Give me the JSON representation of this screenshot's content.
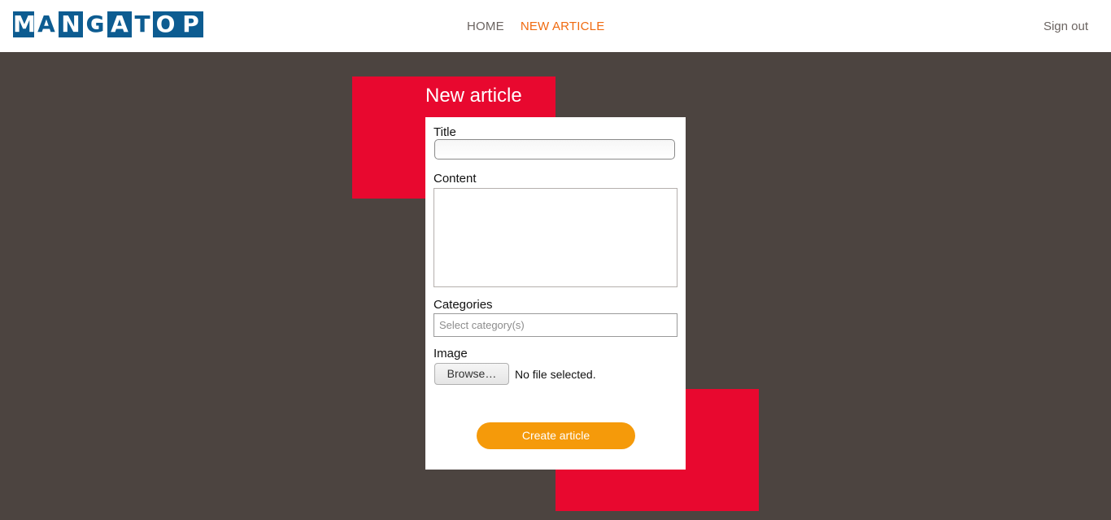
{
  "header": {
    "logo_letters": [
      "M",
      "A",
      "N",
      "G",
      "A",
      "T",
      "O",
      "P"
    ],
    "nav": [
      {
        "label": "HOME"
      },
      {
        "label": "NEW ARTICLE"
      }
    ],
    "signout_label": "Sign out"
  },
  "form": {
    "heading": "New article",
    "title_label": "Title",
    "content_label": "Content",
    "categories_label": "Categories",
    "categories_placeholder": "Select category(s)",
    "image_label": "Image",
    "browse_label": "Browse…",
    "file_status": "No file selected.",
    "submit_label": "Create article"
  },
  "colors": {
    "background": "#4c4440",
    "accent_red": "#e8082f",
    "button_orange": "#f59a0a",
    "active_nav": "#f06a0f",
    "logo_blue": "#0d5c91"
  }
}
